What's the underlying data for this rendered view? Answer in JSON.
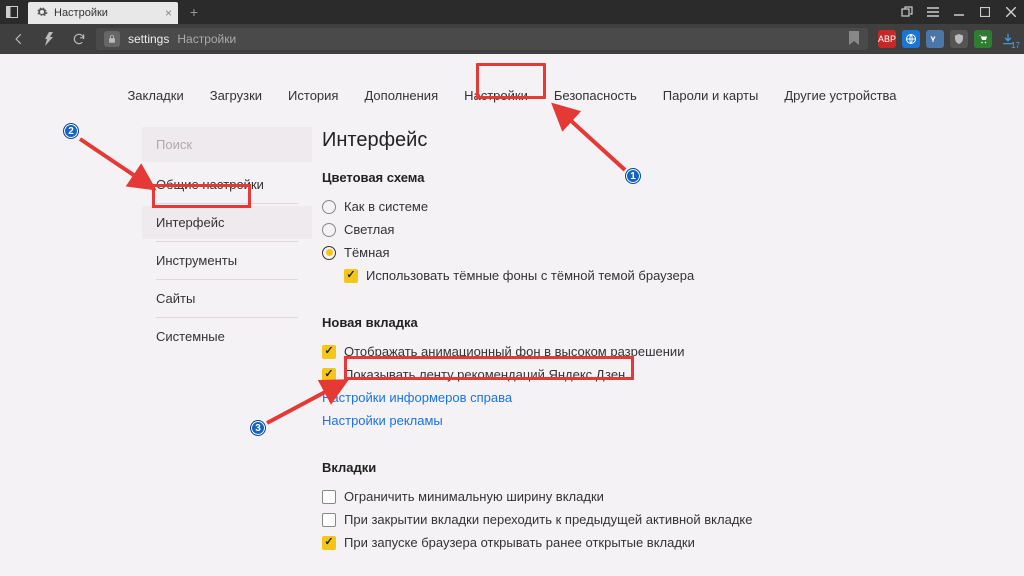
{
  "titlebar": {
    "tab_title": "Настройки"
  },
  "toolbar": {
    "address_prefix": "settings",
    "address_path": "Настройки",
    "download_count": "17"
  },
  "nav": {
    "items": [
      "Закладки",
      "Загрузки",
      "История",
      "Дополнения",
      "Настройки",
      "Безопасность",
      "Пароли и карты",
      "Другие устройства"
    ],
    "active_index": 4
  },
  "sidebar": {
    "search_placeholder": "Поиск",
    "items": [
      "Общие настройки",
      "Интерфейс",
      "Инструменты",
      "Сайты",
      "Системные"
    ],
    "active_index": 1
  },
  "main": {
    "heading": "Интерфейс",
    "color_scheme": {
      "title": "Цветовая схема",
      "options": [
        "Как в системе",
        "Светлая",
        "Тёмная"
      ],
      "selected_index": 2,
      "dark_bg_label": "Использовать тёмные фоны с тёмной темой браузера",
      "dark_bg_checked": true
    },
    "new_tab": {
      "title": "Новая вкладка",
      "hi_res_label": "Отображать анимационный фон в высоком разрешении",
      "hi_res_checked": true,
      "zen_label": "Показывать ленту рекомендаций Яндекс.Дзен",
      "zen_checked": true,
      "informers_link": "Настройки информеров справа",
      "ads_link": "Настройки рекламы"
    },
    "tabs_section": {
      "title": "Вкладки",
      "min_width_label": "Ограничить минимальную ширину вкладки",
      "min_width_checked": false,
      "prev_active_label": "При закрытии вкладки переходить к предыдущей активной вкладке",
      "prev_active_checked": false,
      "restore_label": "При запуске браузера открывать ранее открытые вкладки",
      "restore_checked": true
    }
  },
  "badges": {
    "b1": "1",
    "b2": "2",
    "b3": "3"
  }
}
